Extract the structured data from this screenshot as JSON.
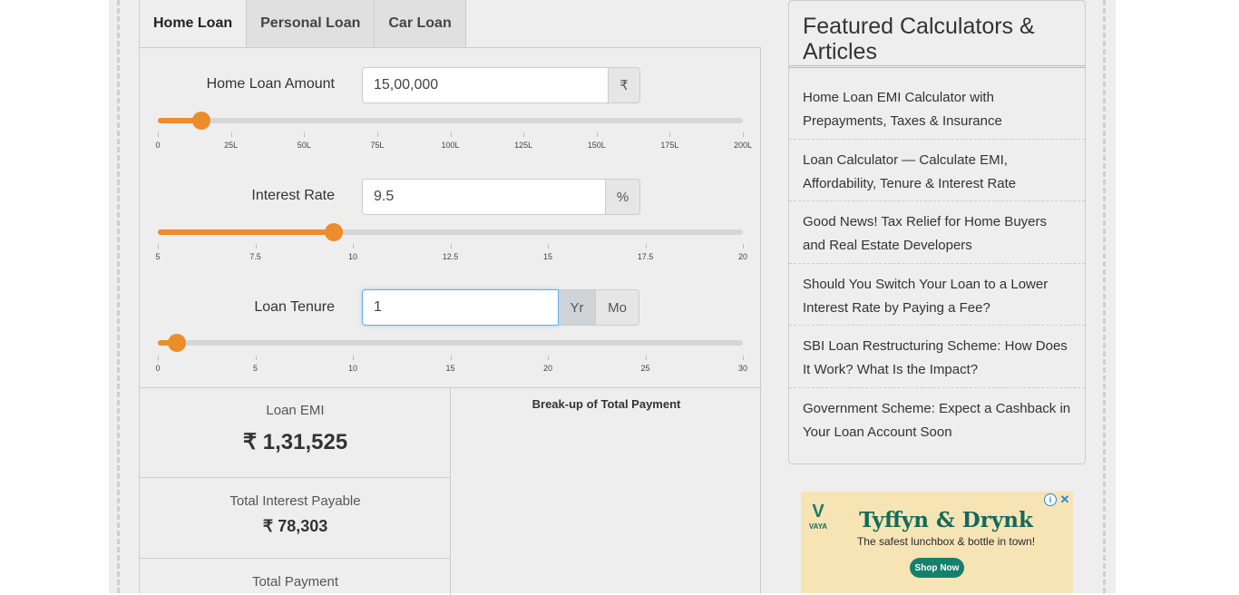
{
  "tabs": [
    {
      "label": "Home Loan",
      "active": true
    },
    {
      "label": "Personal Loan",
      "active": false
    },
    {
      "label": "Car Loan",
      "active": false
    }
  ],
  "loan_amount": {
    "label": "Home Loan Amount",
    "value": "15,00,000",
    "unit": "₹",
    "slider_fraction": 0.075,
    "ticks": [
      "0",
      "25L",
      "50L",
      "75L",
      "100L",
      "125L",
      "150L",
      "175L",
      "200L"
    ]
  },
  "interest_rate": {
    "label": "Interest Rate",
    "value": "9.5",
    "unit": "%",
    "slider_fraction": 0.3,
    "ticks": [
      "5",
      "7.5",
      "10",
      "12.5",
      "15",
      "17.5",
      "20"
    ]
  },
  "loan_tenure": {
    "label": "Loan Tenure",
    "value": "1",
    "unit_year": "Yr",
    "unit_month": "Mo",
    "selected_unit": "Yr",
    "slider_fraction": 0.0333,
    "ticks": [
      "0",
      "5",
      "10",
      "15",
      "20",
      "25",
      "30"
    ]
  },
  "results": {
    "emi_label": "Loan EMI",
    "emi_value": "₹ 1,31,525",
    "interest_label": "Total Interest Payable",
    "interest_value": "₹ 78,303",
    "total_label": "Total Payment",
    "chart_title": "Break-up of Total Payment"
  },
  "sidebar": {
    "title": "Featured Calculators & Articles",
    "items": [
      "Home Loan EMI Calculator with Prepayments, Taxes & Insurance",
      "Loan Calculator — Calculate EMI, Affordability, Tenure & Interest Rate",
      "Good News! Tax Relief for Home Buyers and Real Estate Developers",
      "Should You Switch Your Loan to a Lower Interest Rate by Paying a Fee?",
      "SBI Loan Restructuring Scheme: How Does It Work? What Is the Impact?",
      "Government Scheme: Expect a Cashback in Your Loan Account Soon"
    ]
  },
  "ad": {
    "brand": "VAYA",
    "title": "Tyffyn & Drynk",
    "subtitle": "The safest lunchbox & bottle in town!",
    "button": "Shop Now",
    "info_icon": "info-icon",
    "close_icon": "close-icon"
  },
  "colors": {
    "accent": "#ed8c2b",
    "ad_green": "#16806f"
  }
}
